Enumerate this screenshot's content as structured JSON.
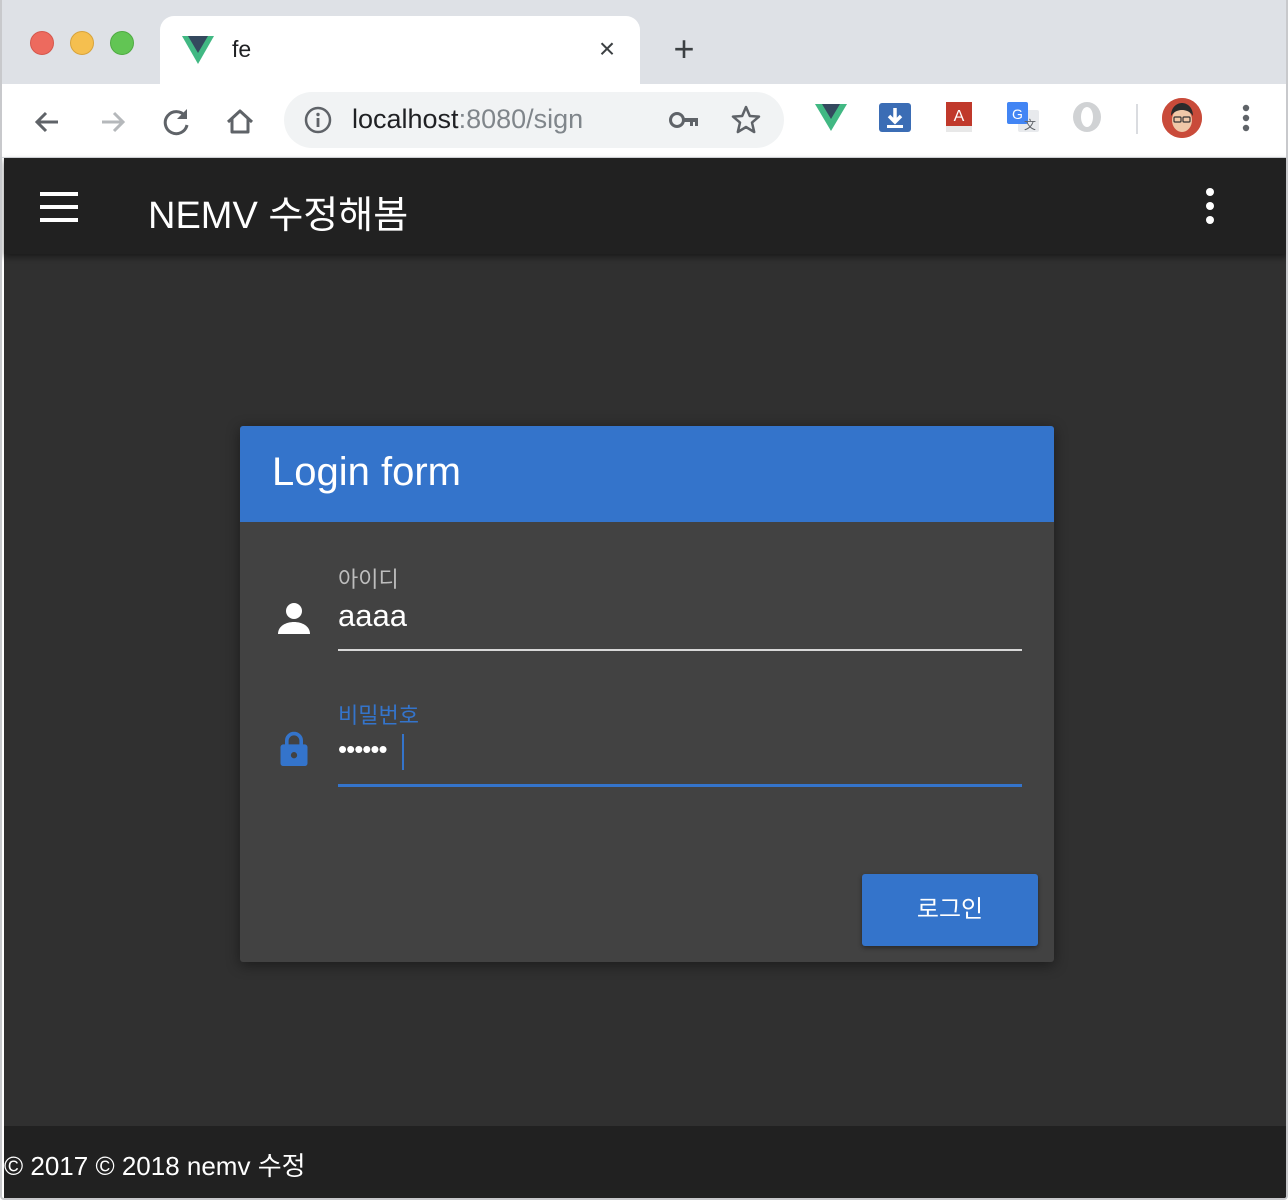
{
  "browser": {
    "tab": {
      "title": "fe",
      "close_label": "×",
      "favicon": "vue-logo-icon"
    },
    "new_tab_label": "+",
    "nav": {
      "back": "arrow-left-icon",
      "forward": "arrow-right-icon",
      "reload": "reload-icon",
      "home": "home-icon"
    },
    "address": {
      "host": "localhost",
      "path": ":8080/sign"
    },
    "extensions": [
      "vue-devtools-icon",
      "download-extension-icon",
      "pdf-extension-icon",
      "google-translate-icon",
      "opera-icon"
    ],
    "colors": {
      "tabstrip": "#dee1e6",
      "omnibox": "#f1f3f4"
    }
  },
  "app": {
    "title": "NEMV 수정해봄",
    "colors": {
      "primary": "#3474cb",
      "background": "#303030",
      "toolbar": "#212121",
      "card": "#424242"
    },
    "login_form": {
      "title": "Login form",
      "id_field": {
        "label": "아이디",
        "value": "aaaa",
        "icon": "person-icon"
      },
      "password_field": {
        "label": "비밀번호",
        "value": "••••••",
        "icon": "lock-icon",
        "focused": true
      },
      "submit_label": "로그인"
    },
    "footer": {
      "text": "© 2017 © 2018 nemv 수정"
    }
  }
}
